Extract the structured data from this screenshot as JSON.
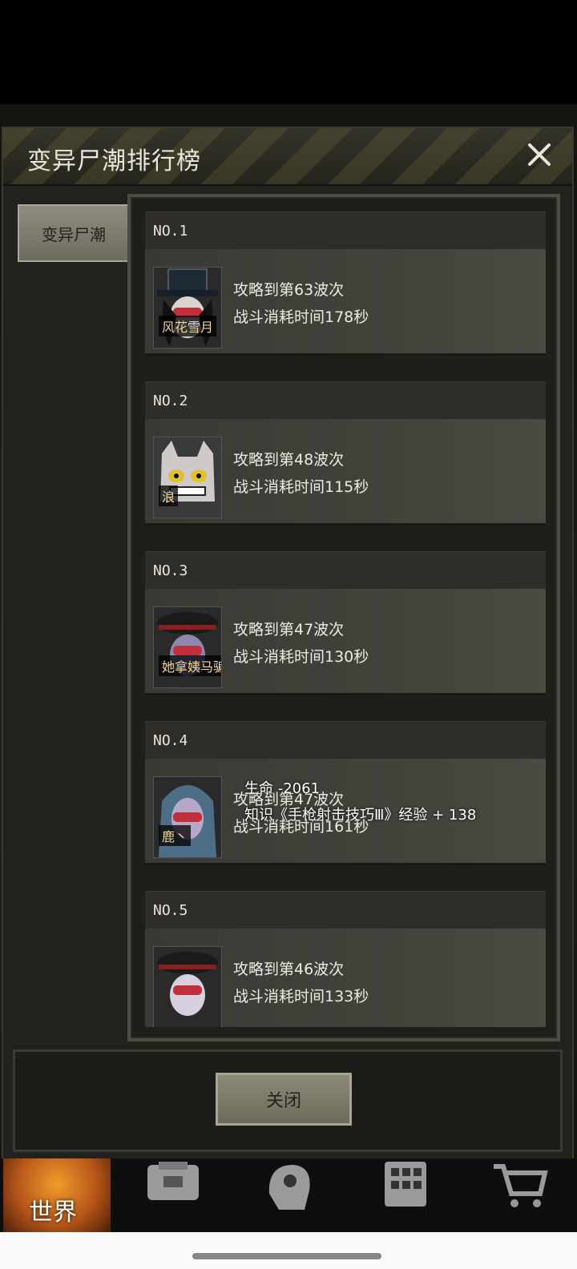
{
  "dialog": {
    "title": "变异尸潮排行榜",
    "side_tab": "变异尸潮",
    "close_button": "关闭"
  },
  "entries": [
    {
      "rank": "NO.1",
      "name": "风花雪月",
      "wave": "攻略到第63波次",
      "time": "战斗消耗时间178秒",
      "avatar": "hat-woman-avatar"
    },
    {
      "rank": "NO.2",
      "name": "浪",
      "wave": "攻略到第48波次",
      "time": "战斗消耗时间115秒",
      "avatar": "cat-avatar"
    },
    {
      "rank": "NO.3",
      "name": "她拿姨马骗我是处",
      "wave": "攻略到第47波次",
      "time": "战斗消耗时间130秒",
      "avatar": "officer-avatar"
    },
    {
      "rank": "NO.4",
      "name": "鹿丶",
      "wave": "攻略到第47波次",
      "time": "战斗消耗时间161秒",
      "avatar": "blue-hair-avatar"
    },
    {
      "rank": "NO.5",
      "name": "",
      "wave": "攻略到第46波次",
      "time": "战斗消耗时间133秒",
      "avatar": "officer-avatar"
    }
  ],
  "overlay": {
    "life": "生命 -2061",
    "exp": "知识《手枪射击技巧Ⅲ》经验 + 138"
  },
  "bottom_nav": {
    "world": "世界"
  }
}
